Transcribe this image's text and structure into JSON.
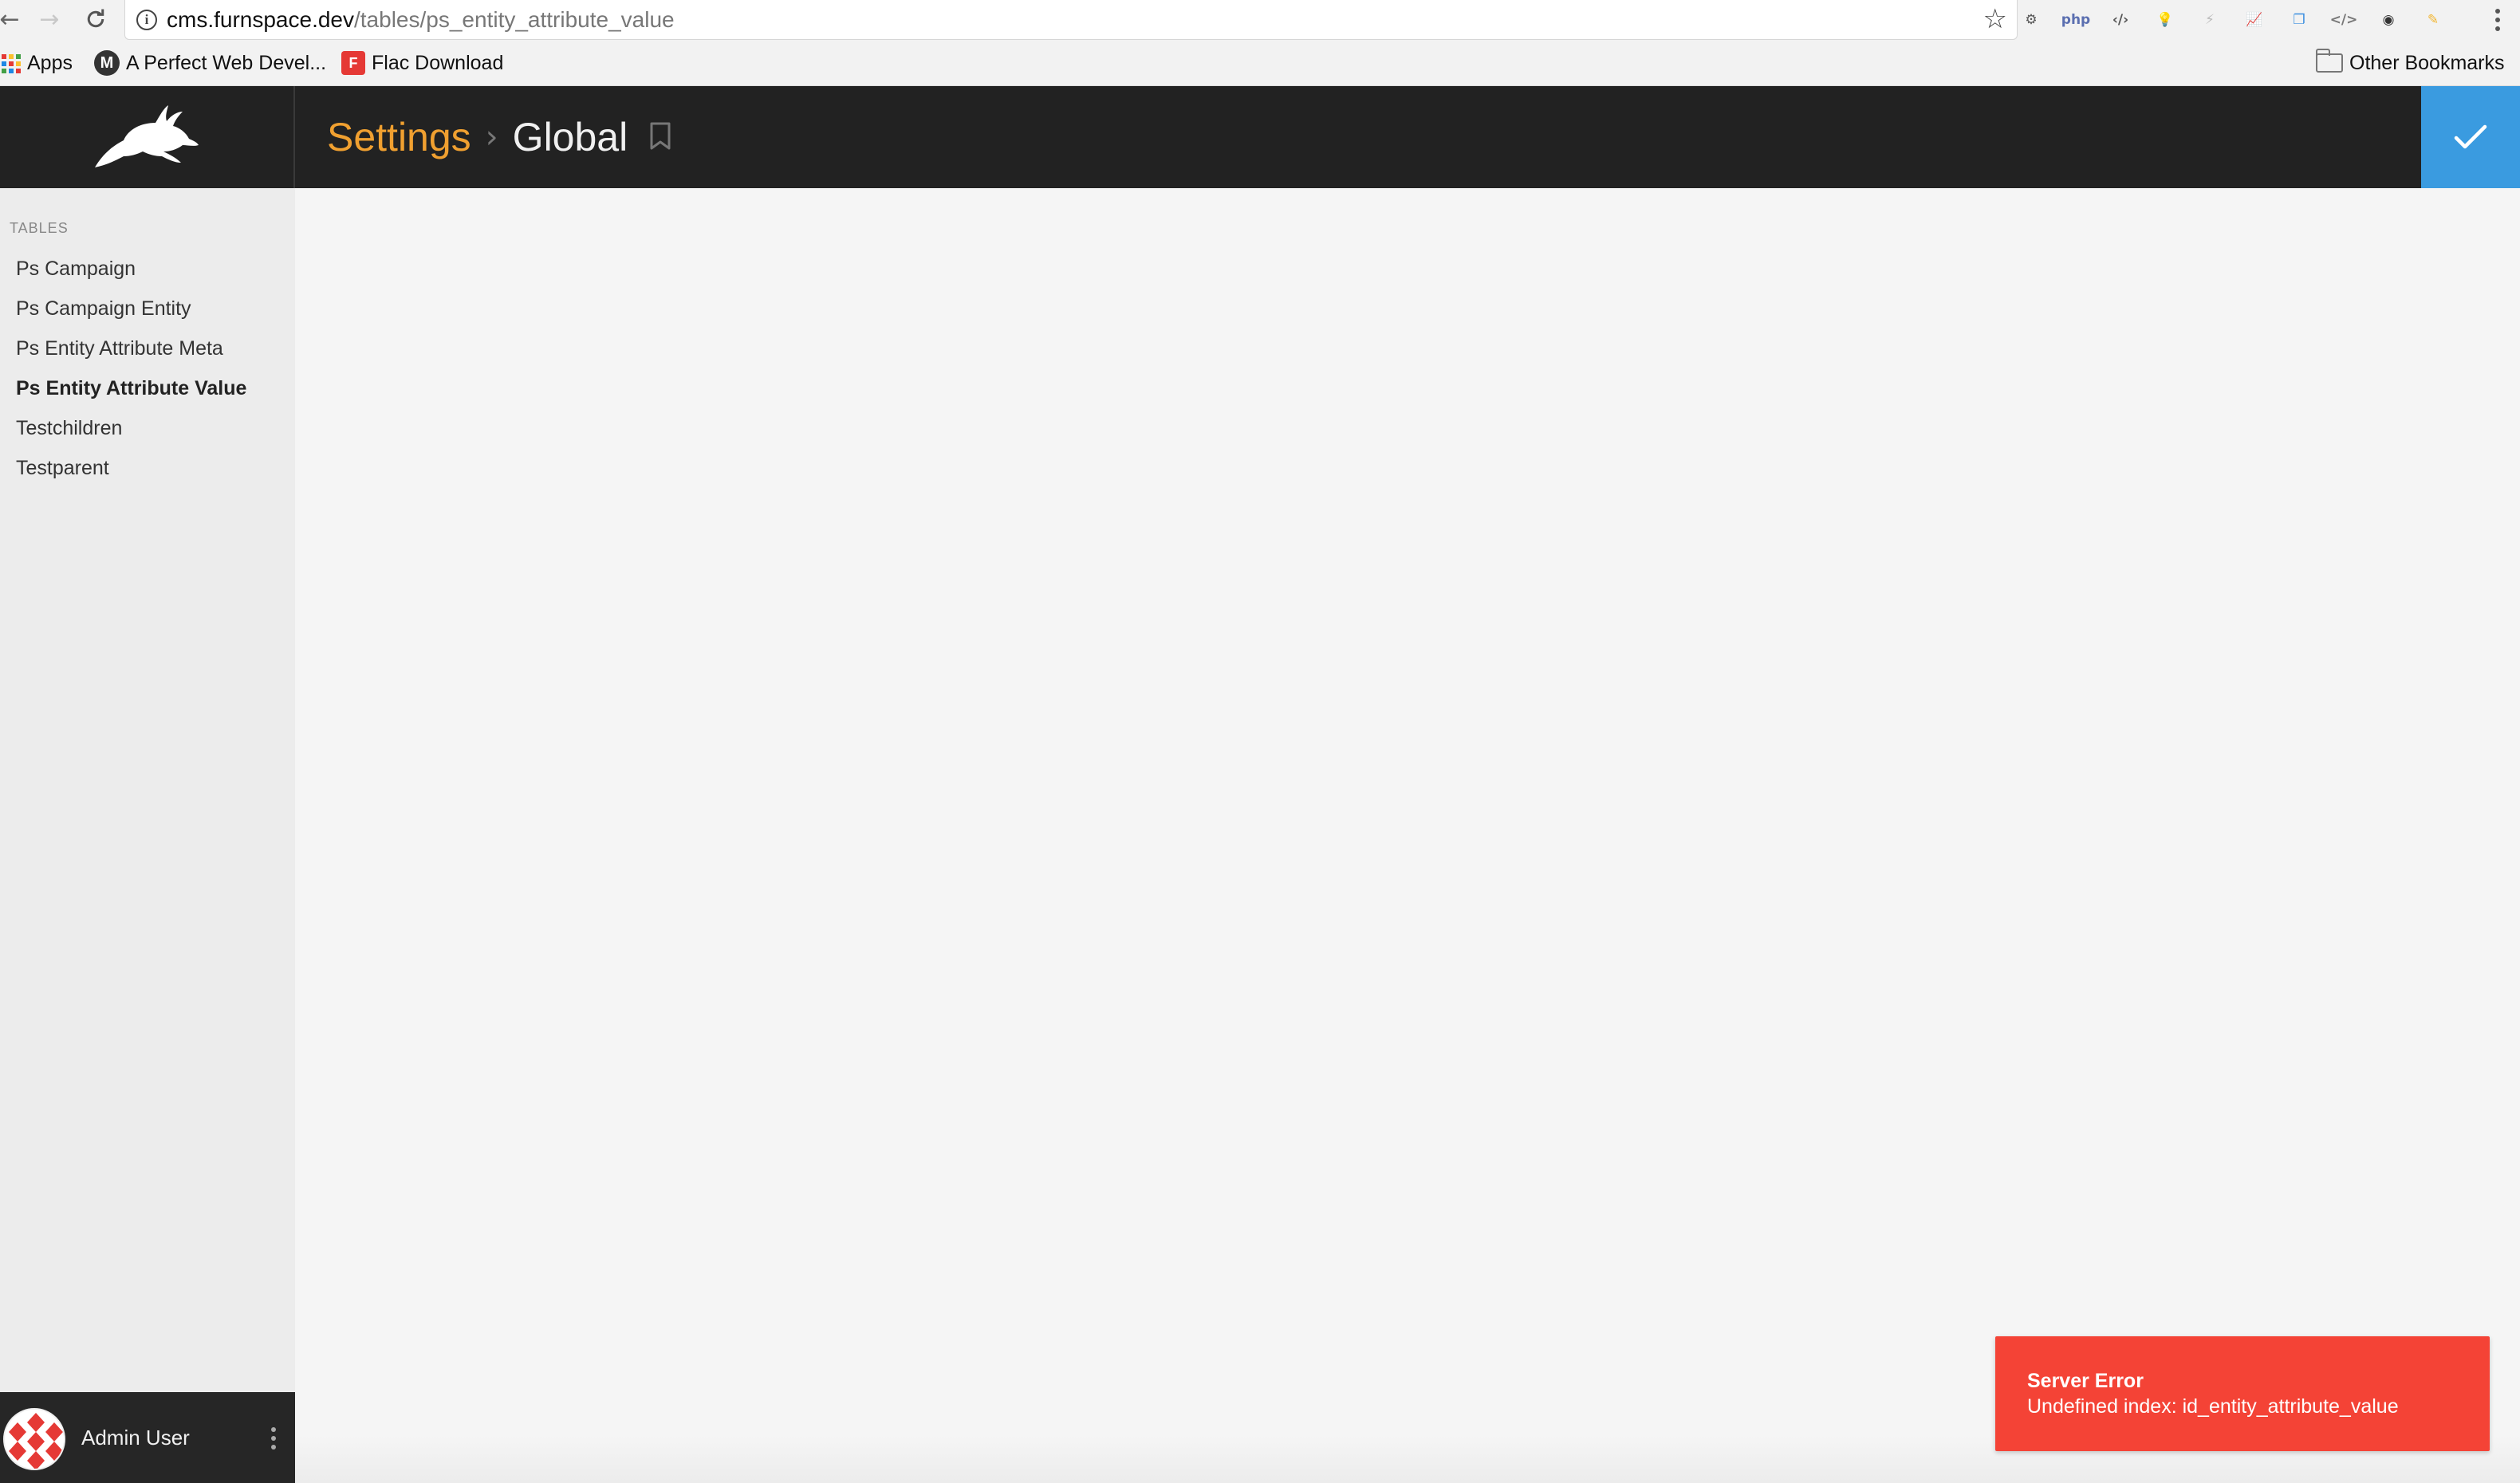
{
  "browser": {
    "url_host": "cms.furnspace.dev",
    "url_path": "/tables/ps_entity_attribute_value",
    "extensions": [
      {
        "name": "gear-extension-icon",
        "glyph": "⚙",
        "color": "#555555"
      },
      {
        "name": "php-extension-icon",
        "glyph": "php",
        "color": "#5b6fb0"
      },
      {
        "name": "code-extension-icon",
        "glyph": "‹/›",
        "color": "#555555"
      },
      {
        "name": "bulb-extension-icon",
        "glyph": "💡",
        "color": "#f2b632"
      },
      {
        "name": "bolt-extension-icon",
        "glyph": "⚡",
        "color": "#bbbbbb"
      },
      {
        "name": "chart-extension-icon",
        "glyph": "📈",
        "color": "#f07b22"
      },
      {
        "name": "window-extension-icon",
        "glyph": "❐",
        "color": "#3b8fe0"
      },
      {
        "name": "devtools-extension-icon",
        "glyph": "</>",
        "color": "#777777"
      },
      {
        "name": "mask-extension-icon",
        "glyph": "◉",
        "color": "#333333"
      },
      {
        "name": "pencil-extension-icon",
        "glyph": "✎",
        "color": "#f2b632"
      }
    ],
    "bookmarks": {
      "apps_label": "Apps",
      "item1_label": "A Perfect Web Devel...",
      "item1_glyph": "M",
      "item2_label": "Flac Download",
      "item2_glyph": "F",
      "other_label": "Other Bookmarks"
    }
  },
  "header": {
    "breadcrumb_parent": "Settings",
    "breadcrumb_separator": "›",
    "breadcrumb_current": "Global"
  },
  "sidebar": {
    "heading": "TABLES",
    "items": [
      {
        "label": "Ps Campaign",
        "active": false
      },
      {
        "label": "Ps Campaign Entity",
        "active": false
      },
      {
        "label": "Ps Entity Attribute Meta",
        "active": false
      },
      {
        "label": "Ps Entity Attribute Value",
        "active": true
      },
      {
        "label": "Testchildren",
        "active": false
      },
      {
        "label": "Testparent",
        "active": false
      }
    ],
    "user_name": "Admin User"
  },
  "toast": {
    "title": "Server Error",
    "message": "Undefined index: id_entity_attribute_value"
  },
  "colors": {
    "accent_orange": "#f0a030",
    "header_bg": "#222222",
    "save_button": "#3a9be0",
    "error_bg": "#f44336"
  }
}
